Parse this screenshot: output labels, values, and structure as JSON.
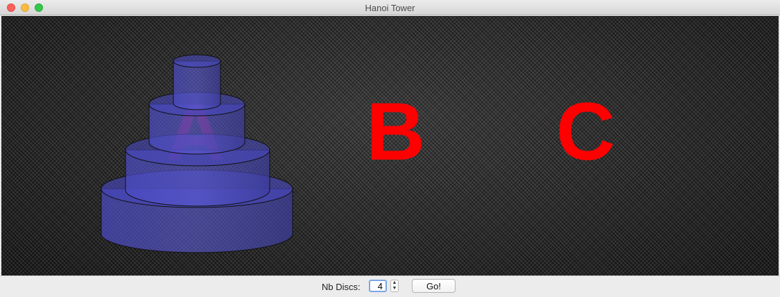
{
  "window": {
    "title": "Hanoi Tower"
  },
  "board": {
    "pegs": [
      {
        "label": "A",
        "discs": 4
      },
      {
        "label": "B",
        "discs": 0
      },
      {
        "label": "C",
        "discs": 0
      }
    ],
    "disc_color": "#3a3aa8",
    "label_color": "#ff0000"
  },
  "controls": {
    "nb_discs_label": "Nb Discs:",
    "nb_discs_value": "4",
    "go_label": "Go!",
    "spinner_up_icon": "chevron-up-icon",
    "spinner_down_icon": "chevron-down-icon"
  }
}
